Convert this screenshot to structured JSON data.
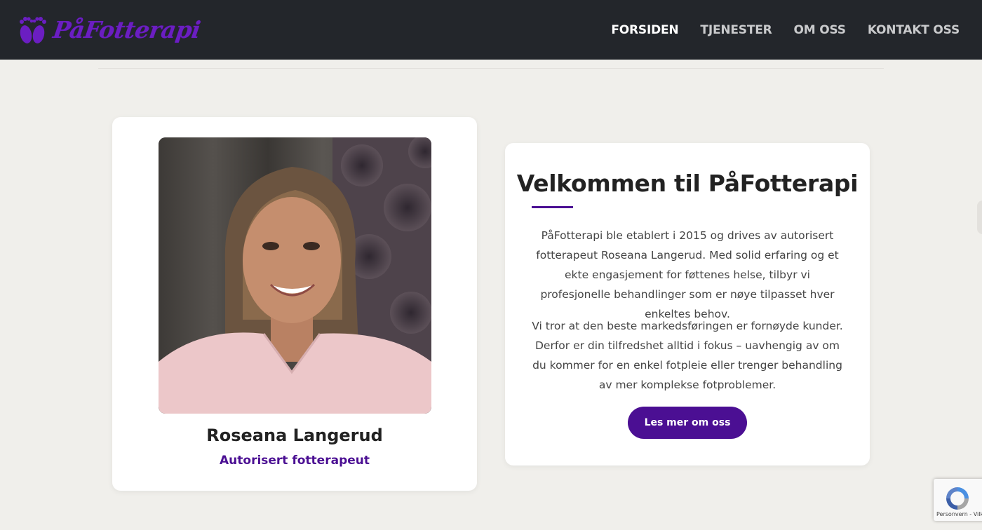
{
  "header": {
    "logo_text": "PåFotterapi",
    "nav": [
      {
        "label": "FORSIDEN",
        "active": true
      },
      {
        "label": "TJENESTER",
        "active": false
      },
      {
        "label": "OM OSS",
        "active": false
      },
      {
        "label": "KONTAKT OSS",
        "active": false
      }
    ]
  },
  "profile": {
    "photo_icon": "portrait-photo",
    "name": "Roseana Langerud",
    "title": "Autorisert fotterapeut"
  },
  "welcome": {
    "title": "Velkommen til PåFotterapi",
    "paragraphs": [
      "PåFotterapi ble etablert i 2015 og drives av autorisert fottera­peut Roseana Langerud. Med solid erfaring og et ekte enga­sjement for føttenes helse, tilbyr vi profesjonelle behandlin­ger som er nøye tilpasset hver enkeltes behov.",
      "Vi tror at den beste markedsføringen er fornøyde kunder. Derfor er din tilfredshet alltid i fokus – uavhengig av om du kommer for en enkel fotpleie eller trenger behandling av mer komplekse fotproblemer."
    ],
    "cta_label": "Les mer om oss"
  },
  "recaptcha": {
    "text": "Personvern - Vilkår"
  },
  "colors": {
    "header_bg": "#23262b",
    "brand_purple": "#4b0f93",
    "page_bg": "#f0efeb"
  }
}
